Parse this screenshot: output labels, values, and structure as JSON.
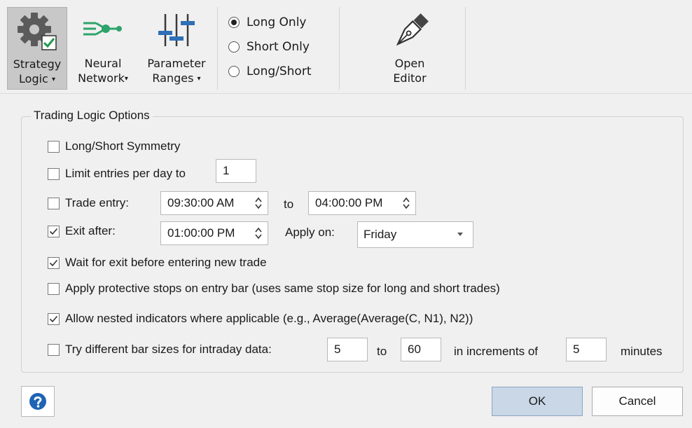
{
  "toolbar": {
    "strategy_logic": {
      "line1": "Strategy",
      "line2": "Logic"
    },
    "neural_network": {
      "line1": "Neural",
      "line2": "Network"
    },
    "parameter_ranges": {
      "line1": "Parameter",
      "line2": "Ranges"
    },
    "dropdown_glyph": "▾",
    "direction_options": [
      {
        "label": "Long Only",
        "selected": true
      },
      {
        "label": "Short Only",
        "selected": false
      },
      {
        "label": "Long/Short",
        "selected": false
      }
    ],
    "open_editor": {
      "line1": "Open",
      "line2": "Editor"
    }
  },
  "options": {
    "title": "Trading Logic Options",
    "symmetry": {
      "label": "Long/Short Symmetry",
      "checked": false
    },
    "limit_entries": {
      "label": "Limit entries per day to",
      "checked": false,
      "value": "1"
    },
    "trade_entry": {
      "label": "Trade entry:",
      "checked": false,
      "from": "09:30:00 AM",
      "to_label": "to",
      "to": "04:00:00 PM"
    },
    "exit_after": {
      "label": "Exit after:",
      "checked": true,
      "time": "01:00:00 PM",
      "apply_label": "Apply on:",
      "apply_value": "Friday"
    },
    "wait_exit": {
      "label": "Wait for exit before entering new trade",
      "checked": true
    },
    "protective_stops": {
      "label": "Apply protective stops on entry bar (uses same stop size for long and short trades)",
      "checked": false
    },
    "nested_indicators": {
      "label": "Allow nested indicators where applicable (e.g., Average(Average(C, N1), N2))",
      "checked": true
    },
    "bar_sizes": {
      "label": "Try different bar sizes for intraday data:",
      "checked": false,
      "from": "5",
      "to_label": "to",
      "to": "60",
      "increments_label": "in increments of",
      "increment": "5",
      "unit": "minutes"
    }
  },
  "footer": {
    "ok": "OK",
    "cancel": "Cancel"
  },
  "colors": {
    "help_icon": "#1e64b4",
    "nn_icon": "#2ea36b",
    "param_icon": "#2f6fb7",
    "ok_button": "#c9d7e6"
  }
}
